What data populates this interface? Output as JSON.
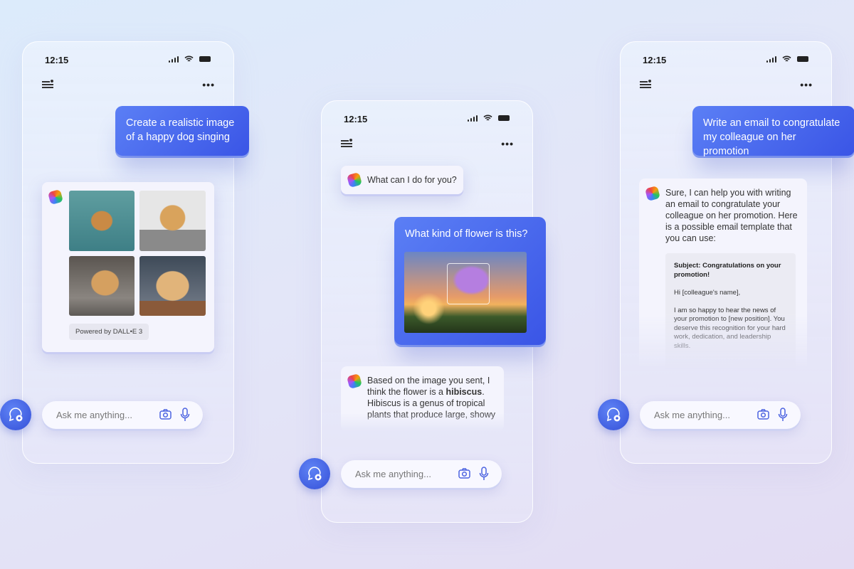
{
  "status": {
    "time": "12:15"
  },
  "colors": {
    "accent": "#3f5ae8",
    "background": "#e3e6f8"
  },
  "input": {
    "placeholder": "Ask me anything..."
  },
  "phone1": {
    "user_message": "Create a realistic image of a happy dog singing",
    "images": [
      "dog-singing-with-sheet-music",
      "dog-with-mic-and-paper",
      "dog-at-microphone",
      "dog-with-headphones"
    ],
    "badge": "Powered by DALL•E 3"
  },
  "phone2": {
    "greeting": "What can I do for you?",
    "user_message": "What kind of flower is this?",
    "response_pre": "Based on the image you sent, I think the flower is a ",
    "response_bold": "hibiscus",
    "response_post": ". Hibiscus is a genus of tropical plants that produce large, showy"
  },
  "phone3": {
    "user_message": "Write an email to congratulate my colleague on her promotion",
    "response": "Sure, I can help you with writing an email to congratulate your colleague on her promotion. Here is a possible email template that you can use:",
    "email_subject": "Subject: Congratulations on your promotion!",
    "email_greeting": "Hi [colleague's name],",
    "email_body": "I am so happy to hear the news of your promotion to [new position]. You deserve this recognition for your hard work, dedication, and leadership skills."
  }
}
